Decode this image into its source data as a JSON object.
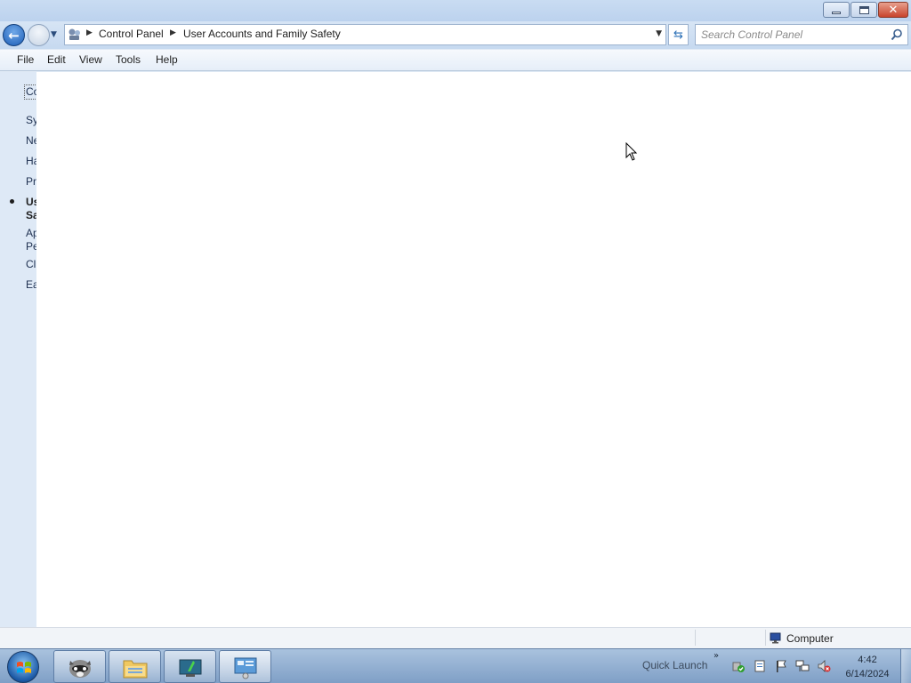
{
  "window": {
    "buttons": {
      "minimize": "minimize",
      "maximize": "restore",
      "close": "close"
    }
  },
  "address": {
    "breadcrumbs": [
      "Control Panel",
      "User Accounts and Family Safety"
    ]
  },
  "search": {
    "placeholder": "Search Control Panel"
  },
  "menu": {
    "items": [
      {
        "label": "File",
        "accel": "F"
      },
      {
        "label": "Edit",
        "accel": "E"
      },
      {
        "label": "View",
        "accel": "V"
      },
      {
        "label": "Tools",
        "accel": "T"
      },
      {
        "label": "Help",
        "accel": "H"
      }
    ]
  },
  "leftnav": {
    "home": "Co",
    "items": [
      {
        "label": "Sy"
      },
      {
        "label": "Ne"
      },
      {
        "label": "Ha"
      },
      {
        "label": "Pr"
      },
      {
        "label": "Us",
        "label2": "Sa",
        "active": true
      },
      {
        "label": "Ap",
        "label2": "Pe"
      },
      {
        "label": "Cl"
      },
      {
        "label": "Ea"
      }
    ]
  },
  "statusbar": {
    "location": "Computer"
  },
  "taskbar": {
    "quick_launch": "Quick Launch",
    "time": "4:42",
    "date": "6/14/2024"
  },
  "colors": {
    "accent": "#1d5eb7",
    "taskbar": "#8eabcf",
    "nav_pane": "#dee9f6"
  }
}
